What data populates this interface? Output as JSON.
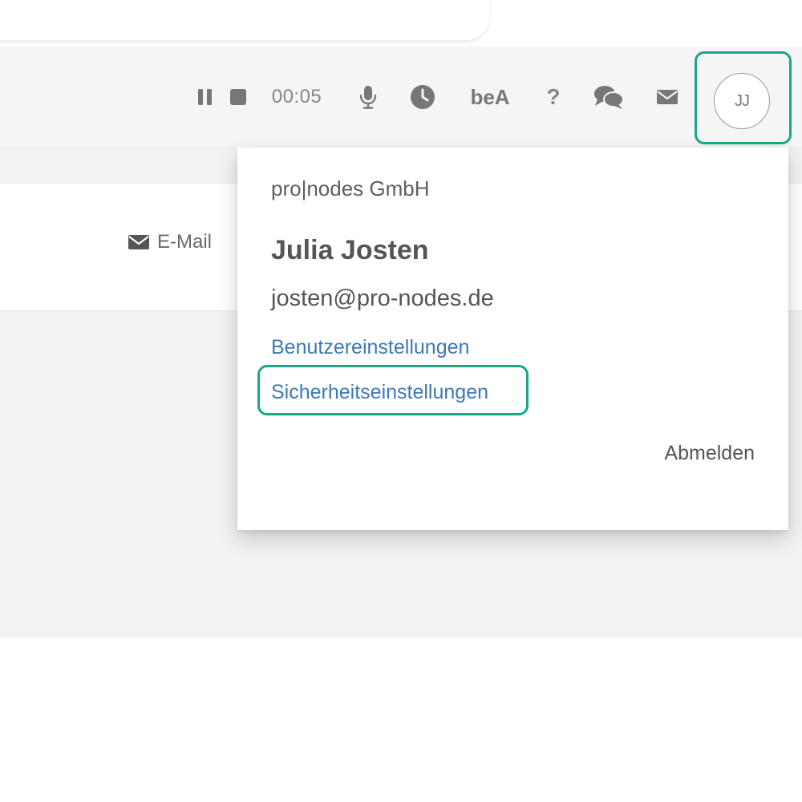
{
  "toolbar": {
    "pause_icon": "pause-icon",
    "stop_icon": "stop-icon",
    "timer": "00:05",
    "microphone_icon": "microphone-icon",
    "clock_icon": "clock-icon",
    "bea_label": "beA",
    "help_label": "?",
    "chat_icon": "chat-bubbles-icon",
    "mail_icon": "envelope-icon",
    "avatar_initials": "JJ"
  },
  "content": {
    "email_label": "E-Mail"
  },
  "dropdown": {
    "company": "pro|nodes GmbH",
    "user_name": "Julia Josten",
    "user_email": "josten@pro-nodes.de",
    "user_settings_label": "Benutzereinstellungen",
    "security_settings_label": "Sicherheitseinstellungen",
    "logout_label": "Abmelden"
  },
  "colors": {
    "highlight": "#1aa68d",
    "link": "#3d78b8",
    "icon": "#777777"
  }
}
